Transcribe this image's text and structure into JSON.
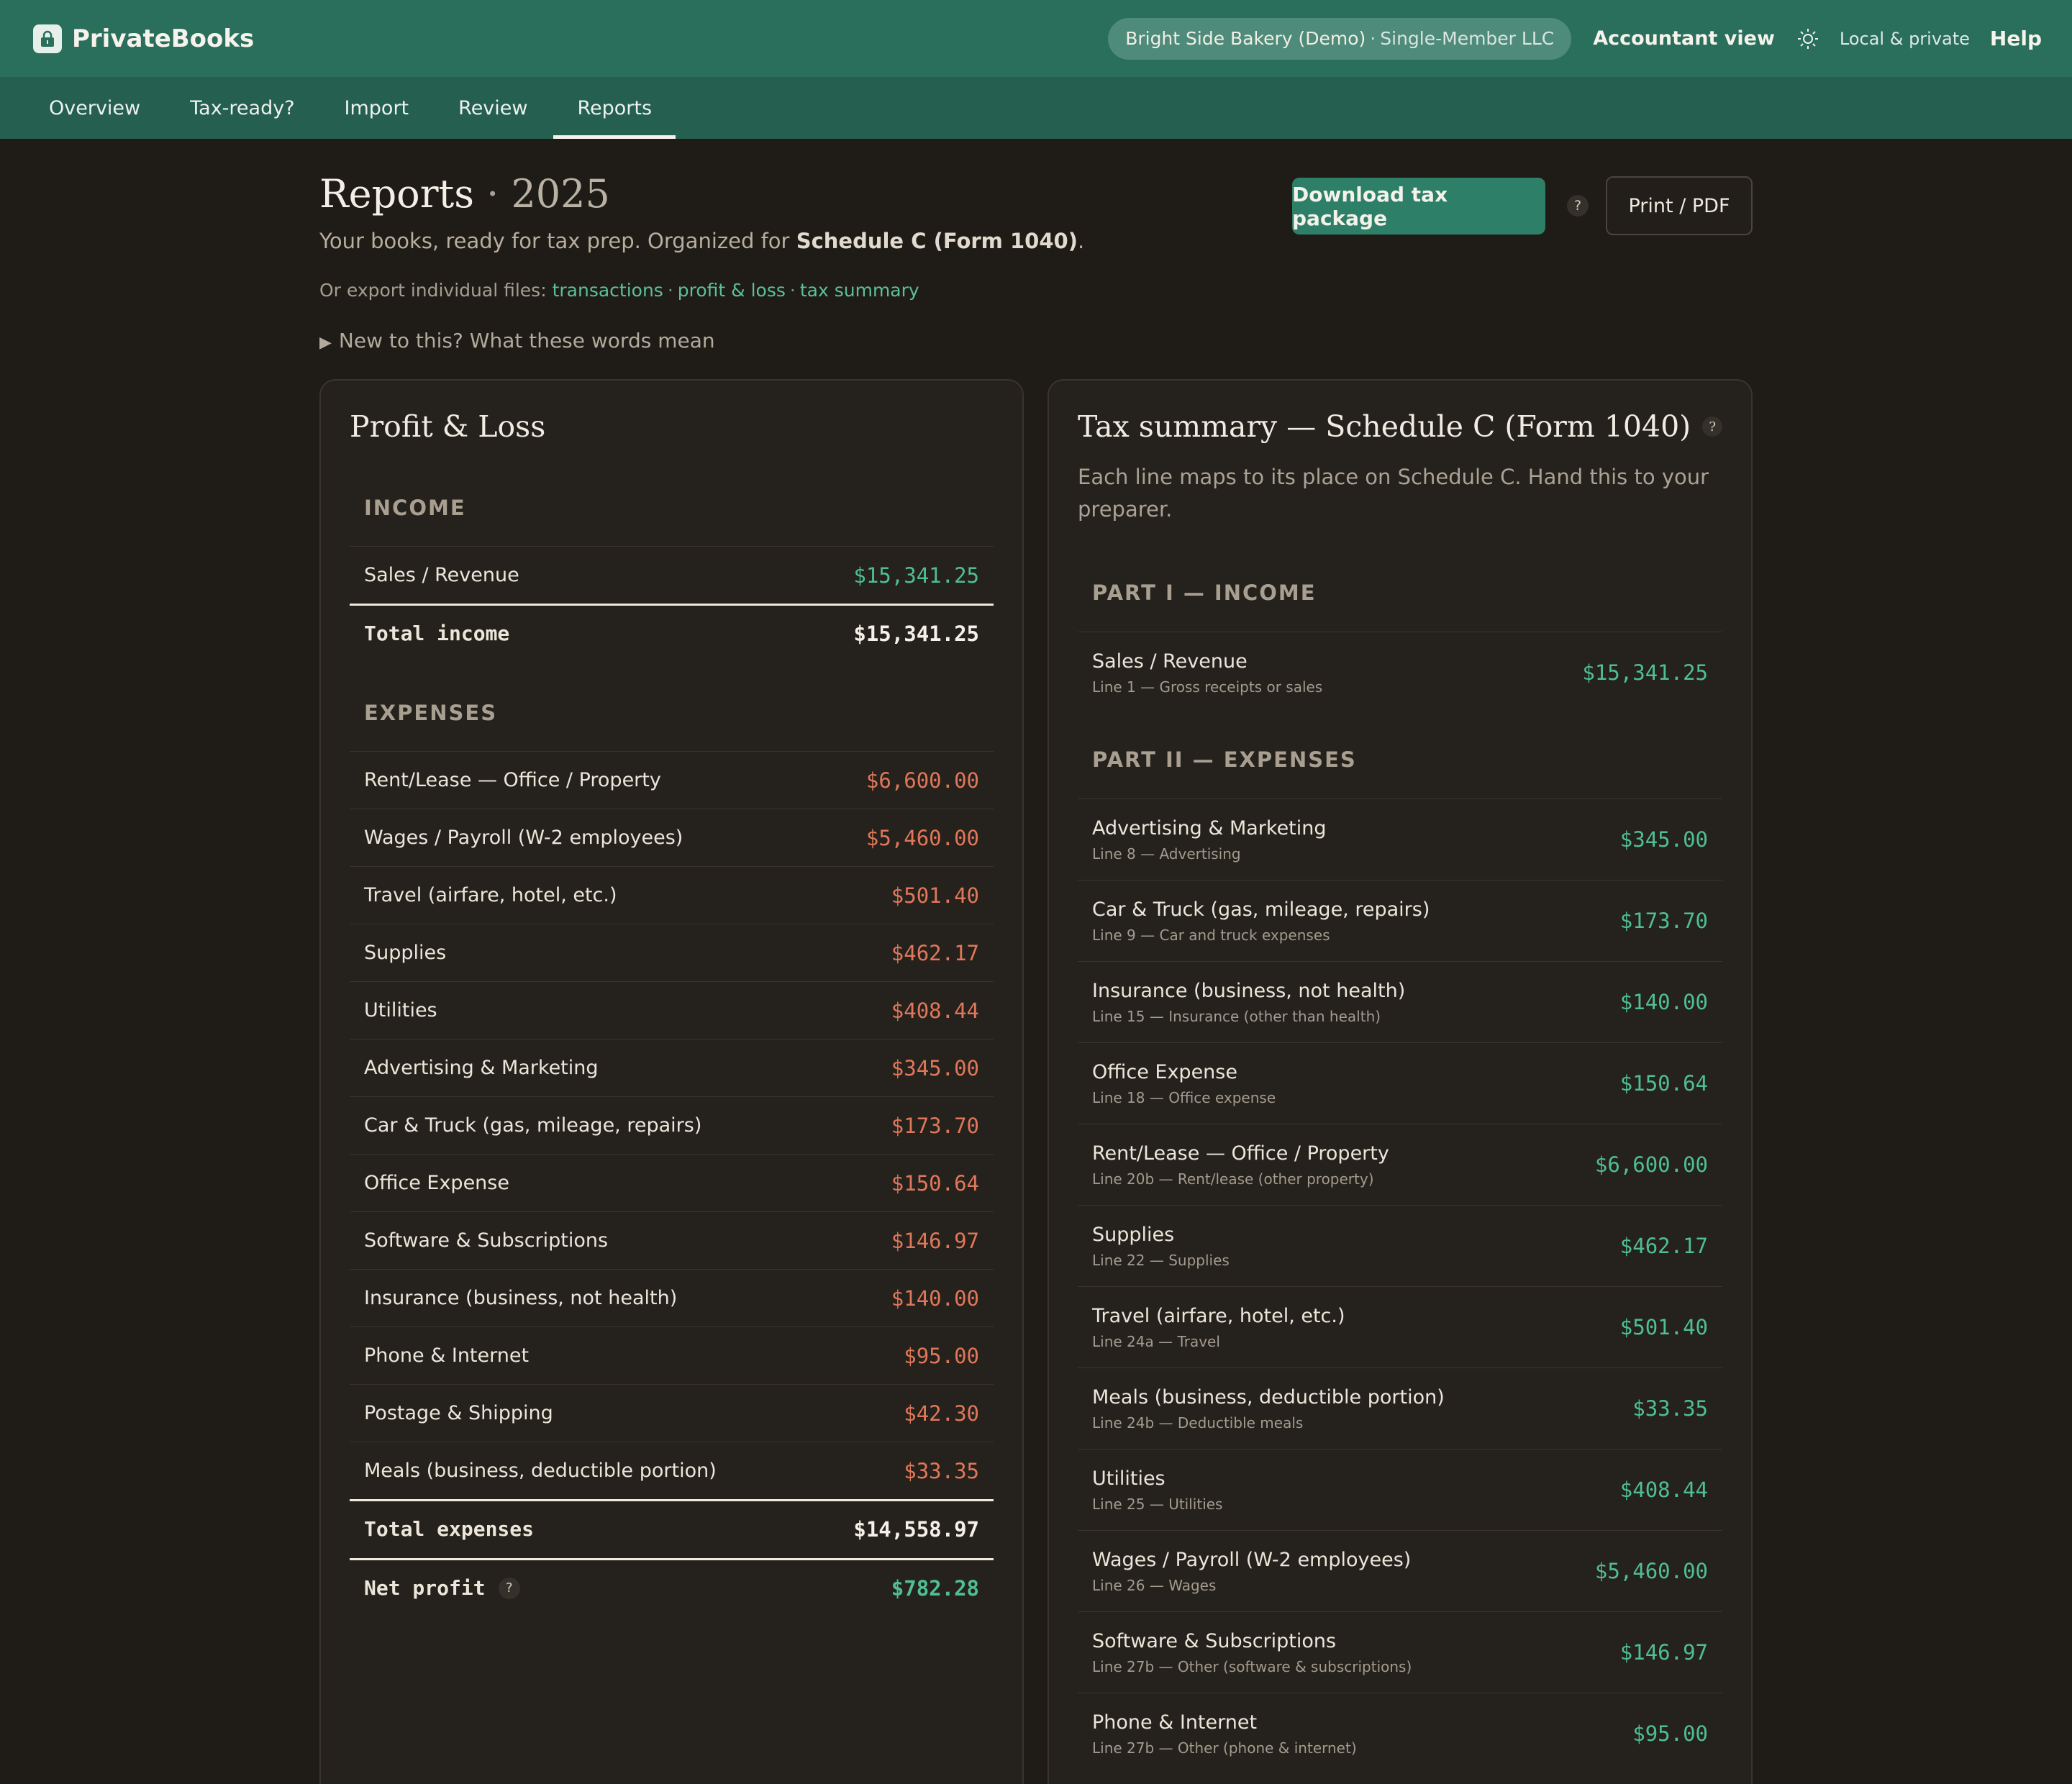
{
  "app": {
    "name": "PrivateBooks",
    "company": "Bright Side Bakery (Demo)",
    "company_sep": "·",
    "entity": "Single-Member LLC",
    "accountant_view": "Accountant view",
    "local_label": "Local & private",
    "help": "Help"
  },
  "nav": {
    "tabs": [
      "Overview",
      "Tax-ready?",
      "Import",
      "Review",
      "Reports"
    ],
    "active": "Reports"
  },
  "header": {
    "title": "Reports",
    "title_sep": "·",
    "year": "2025",
    "subtitle_prefix": "Your books, ready for tax prep. Organized for ",
    "subtitle_bold": "Schedule C (Form 1040)",
    "subtitle_suffix": ".",
    "exports_prefix": "Or export individual files:",
    "export_links": [
      "transactions",
      "profit & loss",
      "tax summary"
    ],
    "export_sep": "·",
    "glossary": "New to this? What these words mean",
    "download_button": "Download tax package",
    "help_glyph": "?",
    "print_button": "Print / PDF"
  },
  "pl": {
    "title": "Profit & Loss",
    "income_label": "INCOME",
    "income_rows": [
      {
        "label": "Sales / Revenue",
        "amount": "$15,341.25"
      }
    ],
    "total_income_label": "Total income",
    "total_income": "$15,341.25",
    "expenses_label": "EXPENSES",
    "expense_rows": [
      {
        "label": "Rent/Lease — Office / Property",
        "amount": "$6,600.00"
      },
      {
        "label": "Wages / Payroll (W-2 employees)",
        "amount": "$5,460.00"
      },
      {
        "label": "Travel (airfare, hotel, etc.)",
        "amount": "$501.40"
      },
      {
        "label": "Supplies",
        "amount": "$462.17"
      },
      {
        "label": "Utilities",
        "amount": "$408.44"
      },
      {
        "label": "Advertising & Marketing",
        "amount": "$345.00"
      },
      {
        "label": "Car & Truck (gas, mileage, repairs)",
        "amount": "$173.70"
      },
      {
        "label": "Office Expense",
        "amount": "$150.64"
      },
      {
        "label": "Software & Subscriptions",
        "amount": "$146.97"
      },
      {
        "label": "Insurance (business, not health)",
        "amount": "$140.00"
      },
      {
        "label": "Phone & Internet",
        "amount": "$95.00"
      },
      {
        "label": "Postage & Shipping",
        "amount": "$42.30"
      },
      {
        "label": "Meals (business, deductible portion)",
        "amount": "$33.35"
      }
    ],
    "total_expenses_label": "Total expenses",
    "total_expenses": "$14,558.97",
    "net_profit_label": "Net profit",
    "net_profit": "$782.28"
  },
  "tax": {
    "title": "Tax summary — Schedule C (Form 1040)",
    "description": "Each line maps to its place on Schedule C. Hand this to your preparer.",
    "part1_label": "PART I — INCOME",
    "income_rows": [
      {
        "label": "Sales / Revenue",
        "line": "Line 1 — Gross receipts or sales",
        "amount": "$15,341.25"
      }
    ],
    "part2_label": "PART II — EXPENSES",
    "expense_rows": [
      {
        "label": "Advertising & Marketing",
        "line": "Line 8 — Advertising",
        "amount": "$345.00"
      },
      {
        "label": "Car & Truck (gas, mileage, repairs)",
        "line": "Line 9 — Car and truck expenses",
        "amount": "$173.70"
      },
      {
        "label": "Insurance (business, not health)",
        "line": "Line 15 — Insurance (other than health)",
        "amount": "$140.00"
      },
      {
        "label": "Office Expense",
        "line": "Line 18 — Office expense",
        "amount": "$150.64"
      },
      {
        "label": "Rent/Lease — Office / Property",
        "line": "Line 20b — Rent/lease (other property)",
        "amount": "$6,600.00"
      },
      {
        "label": "Supplies",
        "line": "Line 22 — Supplies",
        "amount": "$462.17"
      },
      {
        "label": "Travel (airfare, hotel, etc.)",
        "line": "Line 24a — Travel",
        "amount": "$501.40"
      },
      {
        "label": "Meals (business, deductible portion)",
        "line": "Line 24b — Deductible meals",
        "amount": "$33.35"
      },
      {
        "label": "Utilities",
        "line": "Line 25 — Utilities",
        "amount": "$408.44"
      },
      {
        "label": "Wages / Payroll (W-2 employees)",
        "line": "Line 26 — Wages",
        "amount": "$5,460.00"
      },
      {
        "label": "Software & Subscriptions",
        "line": "Line 27b — Other (software & subscriptions)",
        "amount": "$146.97"
      },
      {
        "label": "Phone & Internet",
        "line": "Line 27b — Other (phone & internet)",
        "amount": "$95.00"
      }
    ]
  },
  "colors": {
    "topbar": "#2a6e5c",
    "navbar": "#245f50",
    "background": "#1f1b16",
    "card": "#25211c",
    "accent_green": "#4fbf92",
    "expense_red": "#e0775a",
    "download_button": "#2e7f67"
  },
  "icons": {
    "brand": "lock-icon",
    "theme": "sun-icon",
    "glossary": "triangle-right-icon",
    "help": "question-icon"
  }
}
